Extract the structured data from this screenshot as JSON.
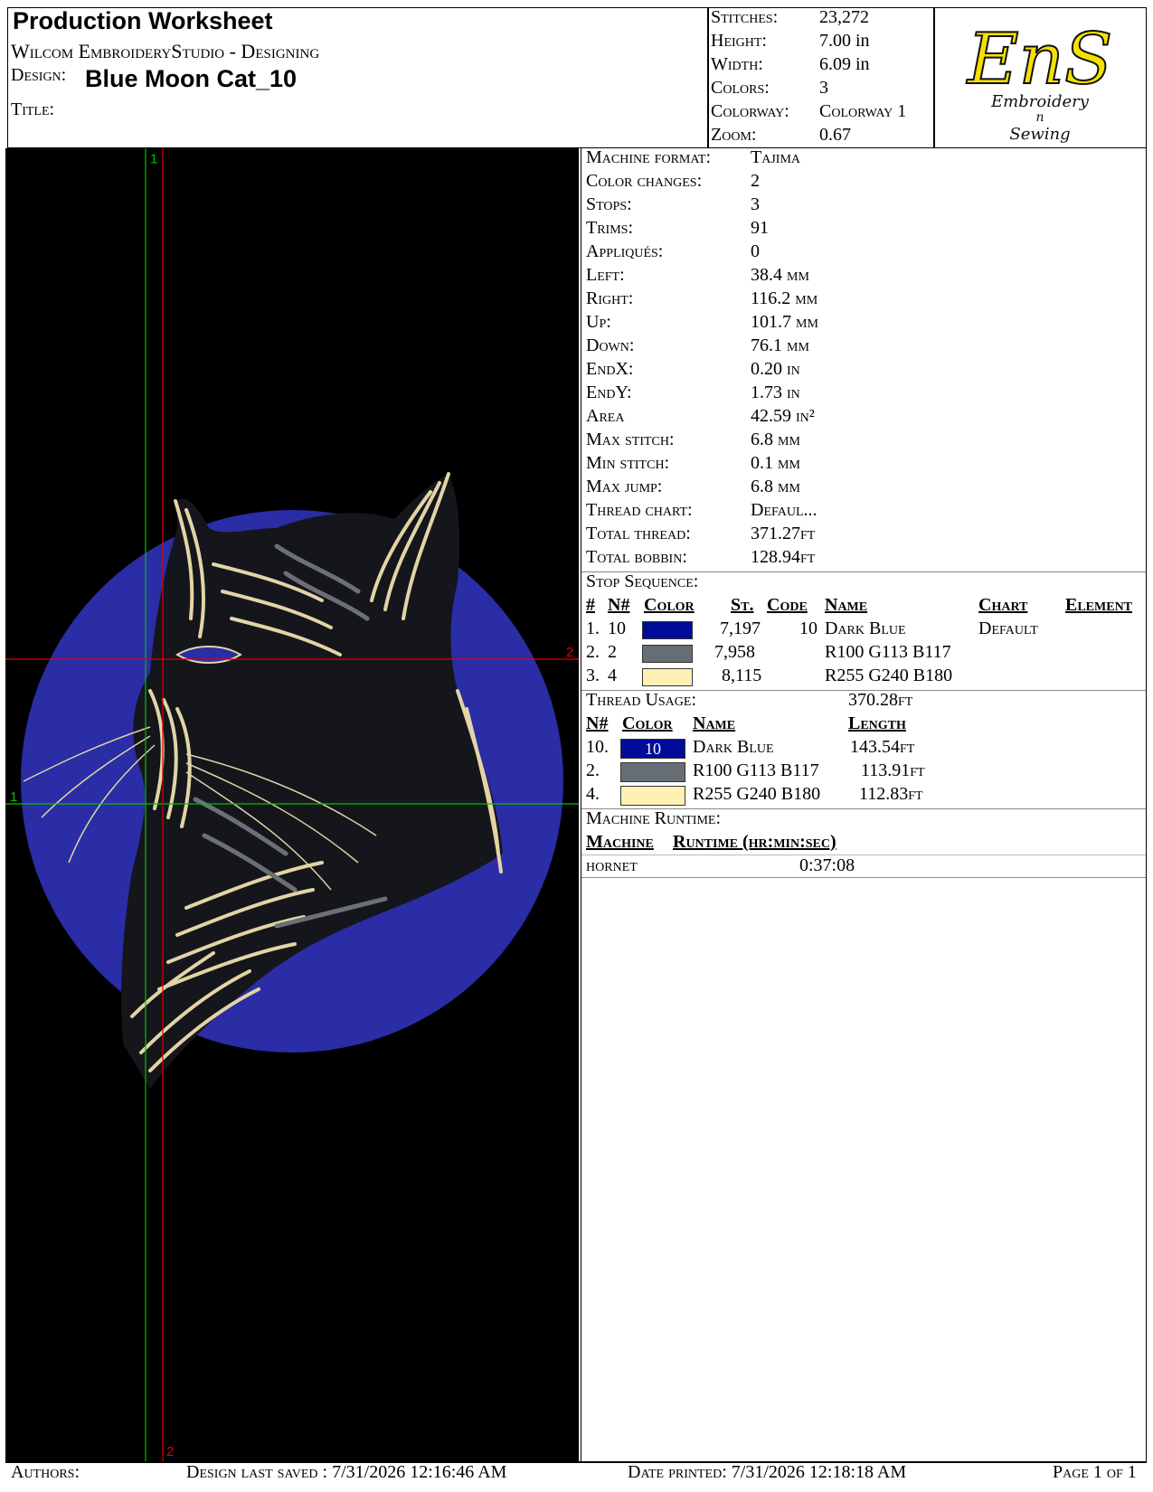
{
  "header": {
    "title": "Production Worksheet",
    "subtitle": "Wilcom EmbroideryStudio - Designing",
    "design_label": "Design:",
    "design_name": "Blue Moon Cat_10",
    "title_label": "Title:",
    "stats": [
      {
        "label": "Stitches:",
        "value": "23,272"
      },
      {
        "label": "Height:",
        "value": "7.00 in"
      },
      {
        "label": "Width:",
        "value": "6.09 in"
      },
      {
        "label": "Colors:",
        "value": "3"
      },
      {
        "label": "Colorway:",
        "value": "Colorway 1"
      },
      {
        "label": "Zoom:",
        "value": "0.67"
      }
    ],
    "logo": {
      "big": "EnS",
      "line1": "Embroidery",
      "line2": "n",
      "line3": "Sewing",
      "color": "#f5e000"
    }
  },
  "preview": {
    "background": "#000000",
    "moon_color": "#2a2da6",
    "fur_color": "#e3d4a6",
    "shade_color": "#6c7076",
    "markers": {
      "green_v": "1",
      "green_h": "1",
      "red_v": "2",
      "red_h": "2"
    }
  },
  "details": [
    {
      "label": "Machine format:",
      "value": "Tajima"
    },
    {
      "label": "Color changes:",
      "value": "2"
    },
    {
      "label": "Stops:",
      "value": "3"
    },
    {
      "label": "Trims:",
      "value": "91"
    },
    {
      "label": "Appliqués:",
      "value": "0"
    },
    {
      "label": "Left:",
      "value": "38.4 mm"
    },
    {
      "label": "Right:",
      "value": "116.2 mm"
    },
    {
      "label": "Up:",
      "value": "101.7 mm"
    },
    {
      "label": "Down:",
      "value": "76.1 mm"
    },
    {
      "label": "EndX:",
      "value": "0.20 in"
    },
    {
      "label": "EndY:",
      "value": "1.73 in"
    },
    {
      "label": "Area",
      "value": " 42.59 in²"
    },
    {
      "label": "Max stitch:",
      "value": "6.8 mm"
    },
    {
      "label": "Min stitch:",
      "value": "0.1 mm"
    },
    {
      "label": "Max jump:",
      "value": "6.8 mm"
    },
    {
      "label": "Thread chart:",
      "value": "Defaul..."
    },
    {
      "label": "Total thread:",
      "value": "371.27ft"
    },
    {
      "label": "Total bobbin:",
      "value": "128.94ft"
    }
  ],
  "stop_sequence": {
    "title": "Stop Sequence:",
    "headers": {
      "num": "#",
      "n": "N#",
      "color": "Color",
      "st": "St.",
      "code": "Code",
      "name": "Name",
      "chart": "Chart",
      "element": "Element"
    },
    "rows": [
      {
        "num": "1.",
        "n": "10",
        "swatch": "#000c99",
        "st": "7,197",
        "code": "10",
        "name": "Dark Blue",
        "chart": "Default"
      },
      {
        "num": "2.",
        "n": "2",
        "swatch": "#646e74",
        "st": "7,958",
        "code": "",
        "name": "R100 G113 B117",
        "chart": ""
      },
      {
        "num": "3.",
        "n": "4",
        "swatch": "#fff0b4",
        "st": "8,115",
        "code": "",
        "name": "R255 G240 B180",
        "chart": ""
      }
    ]
  },
  "thread_usage": {
    "title": "Thread Usage:",
    "total": "370.28ft",
    "headers": {
      "n": "N#",
      "color": "Color",
      "name": "Name",
      "length": "Length"
    },
    "rows": [
      {
        "n": "10.",
        "swatch": "#000c99",
        "swatch_label": "10",
        "name": "Dark Blue",
        "length": "143.54ft"
      },
      {
        "n": "2.",
        "swatch": "#646e74",
        "swatch_label": "",
        "name": "R100 G113 B117",
        "length": "113.91ft"
      },
      {
        "n": "4.",
        "swatch": "#fff0b4",
        "swatch_label": "",
        "name": "R255 G240 B180",
        "length": "112.83ft"
      }
    ]
  },
  "runtime": {
    "title": "Machine Runtime:",
    "header_machine": "Machine",
    "header_runtime": "Runtime (hr:min:sec)",
    "machine": "hornet",
    "time": "0:37:08"
  },
  "footer": {
    "authors": "Authors:",
    "saved": "Design last saved : 7/31/2026 12:16:46 AM",
    "printed": "Date printed: 7/31/2026 12:18:18 AM",
    "page": "Page 1 of 1"
  }
}
